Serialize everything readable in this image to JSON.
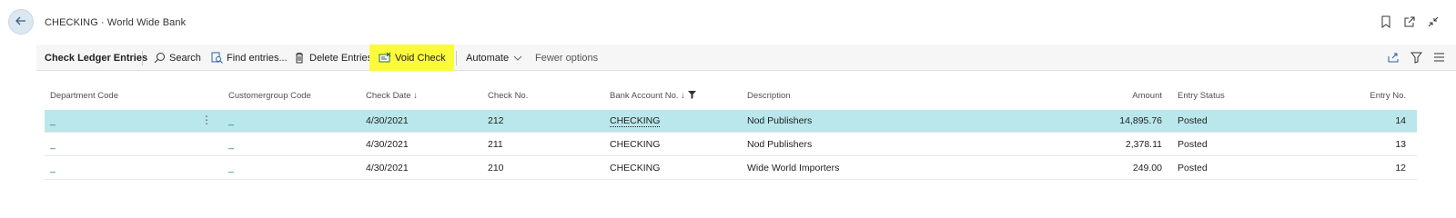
{
  "header": {
    "title": "CHECKING · World Wide Bank"
  },
  "actions": {
    "page_name": "Check Ledger Entries",
    "search": "Search",
    "find_entries": "Find entries...",
    "delete_entries": "Delete Entries",
    "void_check": "Void Check",
    "automate": "Automate",
    "fewer_options": "Fewer options"
  },
  "columns": {
    "department_code": "Department Code",
    "customergroup_code": "Customergroup Code",
    "check_date": "Check Date",
    "check_no": "Check No.",
    "bank_account_no": "Bank Account No.",
    "description": "Description",
    "amount": "Amount",
    "entry_status": "Entry Status",
    "entry_no": "Entry No."
  },
  "rows": [
    {
      "department_code": "_",
      "customergroup_code": "_",
      "check_date": "4/30/2021",
      "check_no": "212",
      "bank_account_no": "CHECKING",
      "description": "Nod Publishers",
      "amount": "14,895.76",
      "entry_status": "Posted",
      "entry_no": "14"
    },
    {
      "department_code": "_",
      "customergroup_code": "_",
      "check_date": "4/30/2021",
      "check_no": "211",
      "bank_account_no": "CHECKING",
      "description": "Nod Publishers",
      "amount": "2,378.11",
      "entry_status": "Posted",
      "entry_no": "13"
    },
    {
      "department_code": "_",
      "customergroup_code": "_",
      "check_date": "4/30/2021",
      "check_no": "210",
      "bank_account_no": "CHECKING",
      "description": "Wide World Importers",
      "amount": "249.00",
      "entry_status": "Posted",
      "entry_no": "12"
    }
  ],
  "icons": {
    "back": "arrow-left-icon",
    "bookmark": "bookmark-icon",
    "open_new": "open-new-window-icon",
    "collapse": "collapse-icon",
    "search": "search-icon",
    "find": "find-entries-icon",
    "delete": "trash-icon",
    "void": "void-check-icon",
    "share": "share-icon",
    "filter": "filter-icon",
    "list": "list-icon"
  },
  "colors": {
    "highlight": "#fbfb3c",
    "selected_row": "#b9e7eb",
    "accent": "#0b6a8a"
  }
}
